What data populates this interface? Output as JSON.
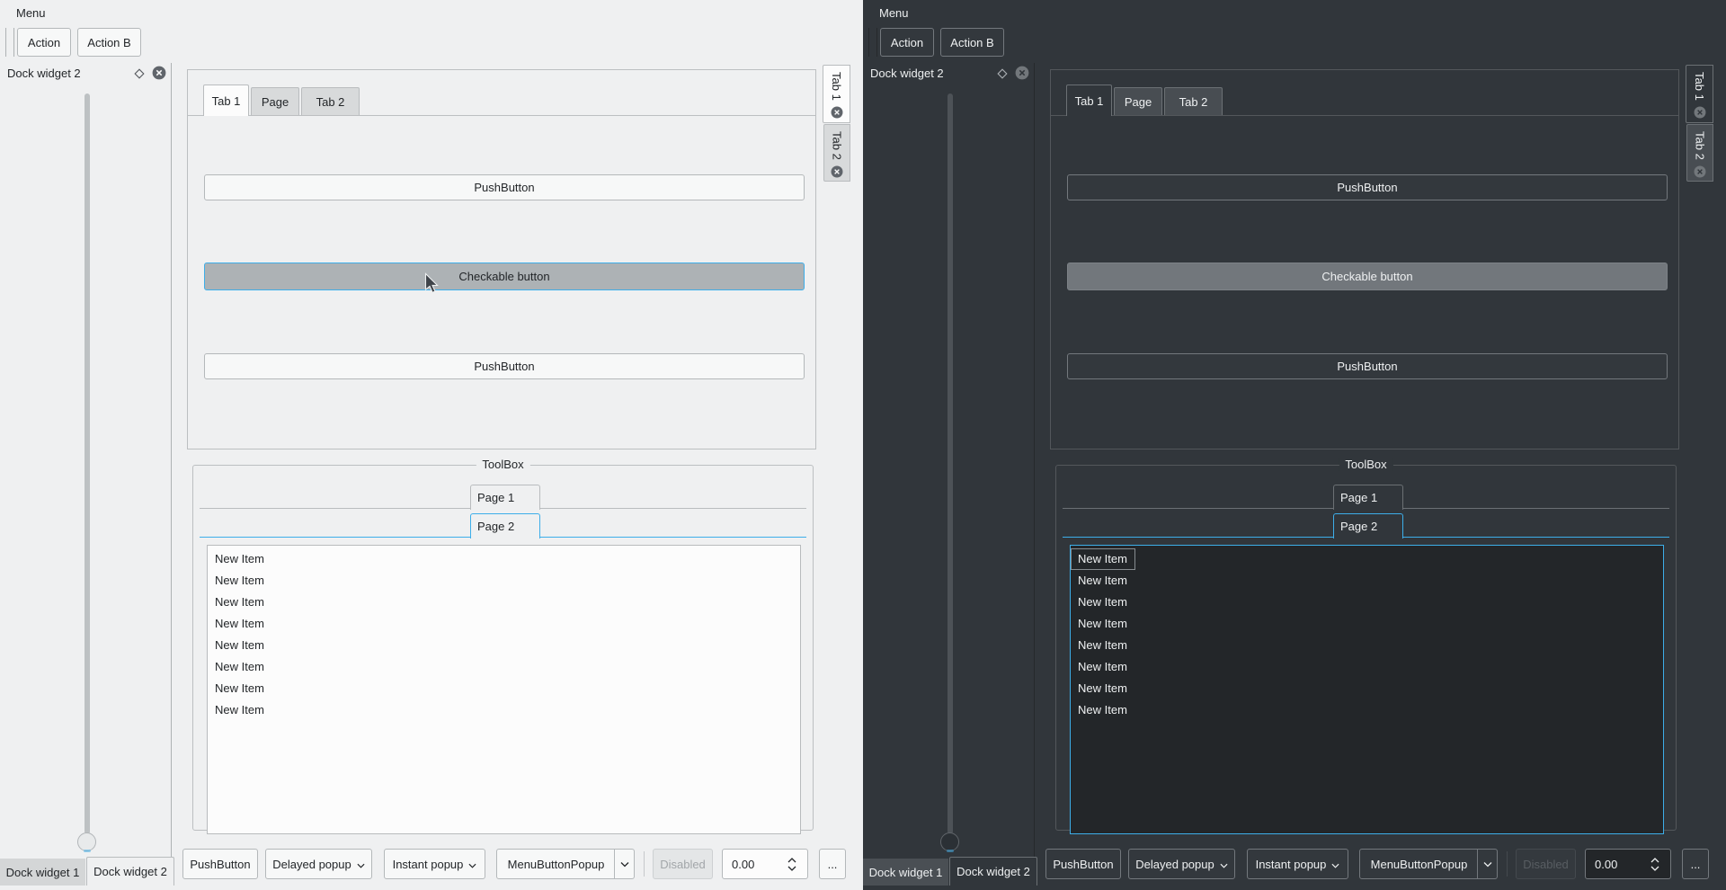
{
  "themes": [
    {
      "name": "light"
    },
    {
      "name": "dark"
    }
  ],
  "colors": {
    "accent": "#3daee9",
    "light_window": "#eff0f1",
    "light_text": "#232629",
    "dark_window": "#31363b",
    "dark_text": "#eef0f1",
    "checked_button_light": "#adb2b5",
    "checked_button_dark": "#72777c"
  },
  "menubar": {
    "menu": "Menu"
  },
  "toolbar": {
    "action": "Action",
    "action_b": "Action B"
  },
  "dock": {
    "title": "Dock widget 2",
    "float_icon": "diamond-icon",
    "close_icon": "circle-x-icon",
    "slider_handle_position": "bottom"
  },
  "main_tabs": {
    "items": [
      "Tab 1",
      "Page",
      "Tab 2"
    ],
    "selected": "Tab 1"
  },
  "tab_content": {
    "push_button_top": "PushButton",
    "checkable_button": "Checkable button",
    "checkable_checked": true,
    "push_button_bottom": "PushButton"
  },
  "side_tabs": {
    "items": [
      "Tab 1",
      "Tab 2"
    ],
    "selected": "Tab 1",
    "close_icon": "circle-x-icon"
  },
  "toolbox": {
    "title": "ToolBox",
    "pages": [
      "Page 1",
      "Page 2"
    ],
    "selected_page": "Page 2",
    "list_items": [
      "New Item",
      "New Item",
      "New Item",
      "New Item",
      "New Item",
      "New Item",
      "New Item",
      "New Item"
    ]
  },
  "bottom_dock_tabs": {
    "items": [
      "Dock widget 1",
      "Dock widget 2"
    ],
    "selected": "Dock widget 2"
  },
  "bottom_toolbar": {
    "push_button": "PushButton",
    "delayed_popup": "Delayed popup",
    "instant_popup": "Instant popup",
    "menu_button_popup": "MenuButtonPopup",
    "disabled_button": "Disabled",
    "spinbox_value": "0.00",
    "more_button": "...",
    "popup_indicator_icon": "chevron-down-icon",
    "spin_up_icon": "chevron-up-icon",
    "spin_down_icon": "chevron-down-icon"
  },
  "cursor": {
    "icon": "arrow-pointer-icon",
    "over": "Checkable button"
  }
}
